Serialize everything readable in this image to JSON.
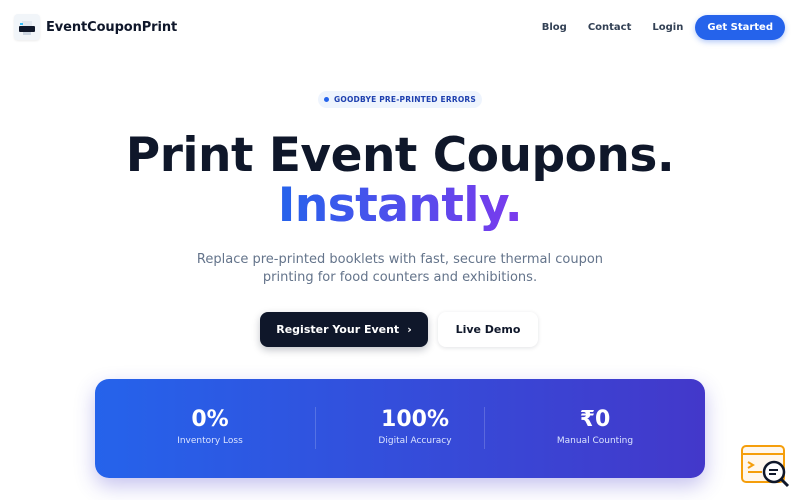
{
  "nav": {
    "brand": "EventCouponPrint",
    "links": [
      "Blog",
      "Contact",
      "Login"
    ],
    "cta": "Get Started"
  },
  "hero": {
    "badge": "GOODBYE PRE-PRINTED ERRORS",
    "title_line1": "Print Event Coupons.",
    "title_line2": "Instantly.",
    "subtitle_line1": "Replace pre-printed booklets with fast, secure thermal coupon",
    "subtitle_line2": "printing for food counters and exhibitions.",
    "primary_cta": "Register Your Event",
    "secondary_cta": "Live Demo"
  },
  "stats": [
    {
      "value": "0%",
      "label": "Inventory Loss"
    },
    {
      "value": "100%",
      "label": "Digital Accuracy"
    },
    {
      "value": "₹0",
      "label": "Manual Counting"
    }
  ],
  "colors": {
    "accent": "#2563eb",
    "accent_purple": "#7c3aed",
    "dark": "#0f172a"
  }
}
